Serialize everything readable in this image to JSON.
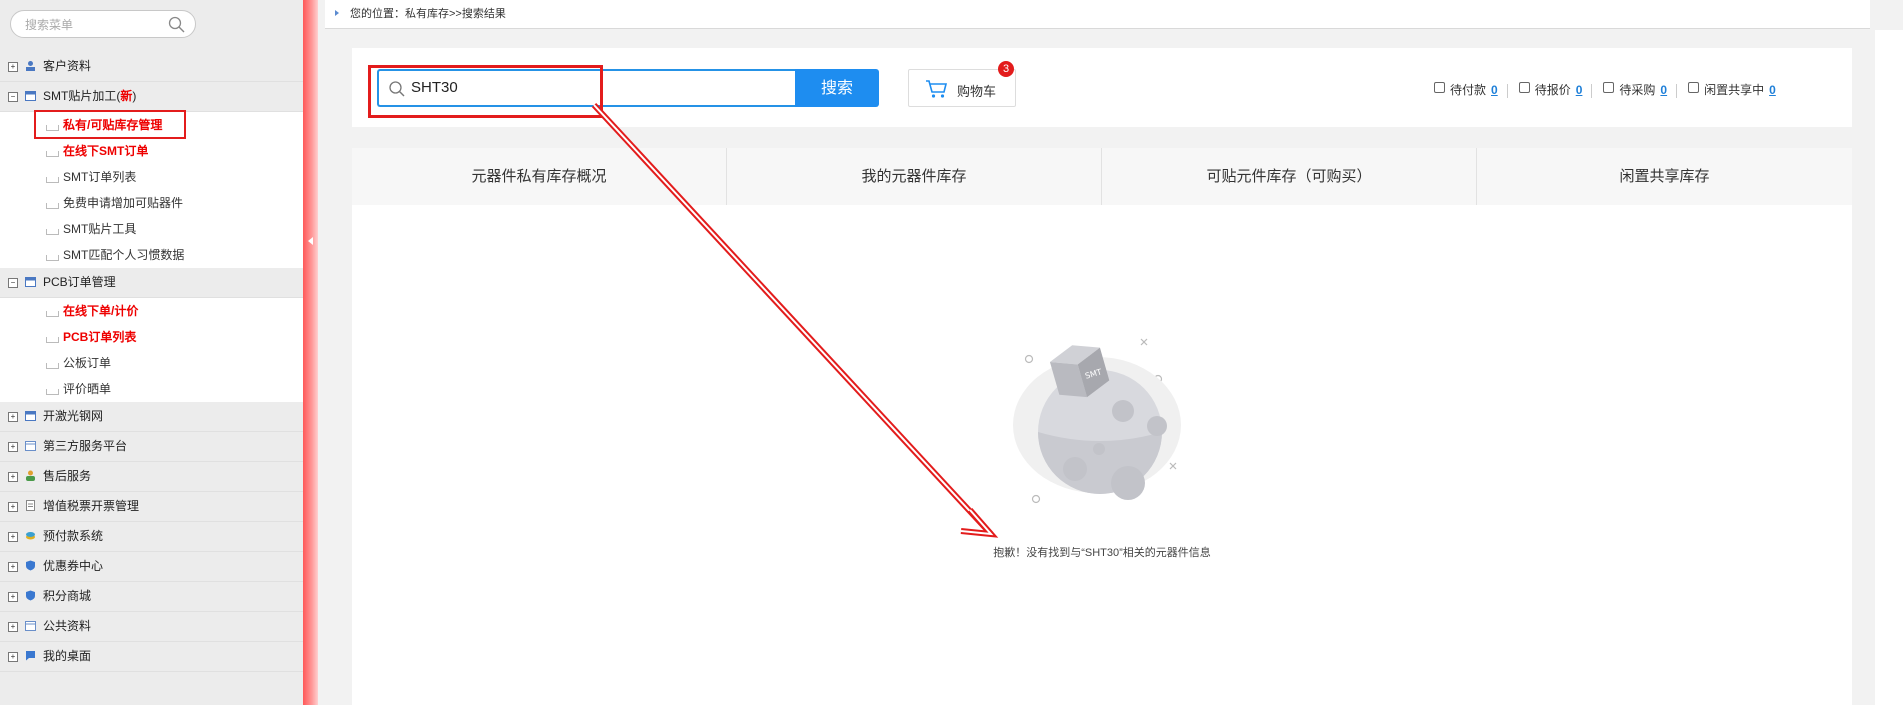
{
  "sidebar": {
    "search_placeholder": "搜索菜单",
    "groups": [
      {
        "label": "客户资料",
        "icon": "user-icon"
      },
      {
        "label": "SMT贴片加工(",
        "new": "新",
        "close": ")",
        "icon": "calendar-icon",
        "items": [
          "私有/可贴库存管理",
          "在线下SMT订单",
          "SMT订单列表",
          "免费申请增加可贴器件",
          "SMT贴片工具",
          "SMT匹配个人习惯数据"
        ]
      },
      {
        "label": "PCB订单管理",
        "icon": "calendar-icon",
        "items": [
          "在线下单/计价",
          "PCB订单列表",
          "公板订单",
          "评价晒单"
        ]
      },
      {
        "label": "开激光钢网",
        "icon": "calendar-icon"
      },
      {
        "label": "第三方服务平台",
        "icon": "window-icon"
      },
      {
        "label": "售后服务",
        "icon": "people-icon"
      },
      {
        "label": "增值税票开票管理",
        "icon": "document-icon"
      },
      {
        "label": "预付款系统",
        "icon": "coins-icon"
      },
      {
        "label": "优惠券中心",
        "icon": "shield-icon"
      },
      {
        "label": "积分商城",
        "icon": "shield-icon"
      },
      {
        "label": "公共资料",
        "icon": "window-icon"
      },
      {
        "label": "我的桌面",
        "icon": "chat-icon"
      }
    ]
  },
  "breadcrumb": "您的位置：私有库存>>搜索结果",
  "search": {
    "value": "SHT30",
    "button": "搜索"
  },
  "cart": {
    "label": "购物车",
    "count": "3"
  },
  "stats": [
    {
      "label": "待付款",
      "value": "0",
      "icon": "wallet-icon"
    },
    {
      "label": "待报价",
      "value": "0",
      "icon": "quote-icon"
    },
    {
      "label": "待采购",
      "value": "0",
      "icon": "clipboard-icon"
    },
    {
      "label": "闲置共享中",
      "value": "0",
      "icon": "share-icon"
    }
  ],
  "tabs": [
    "元器件私有库存概况",
    "我的元器件库存",
    "可贴元件库存（可购买）",
    "闲置共享库存"
  ],
  "empty": {
    "message": "抱歉！没有找到与“SHT30”相关的元器件信息",
    "illustration_label": "SMT"
  },
  "colors": {
    "accent": "#1e8df0",
    "highlight": "#e31c1c",
    "sidebar_active": "#e00000"
  }
}
